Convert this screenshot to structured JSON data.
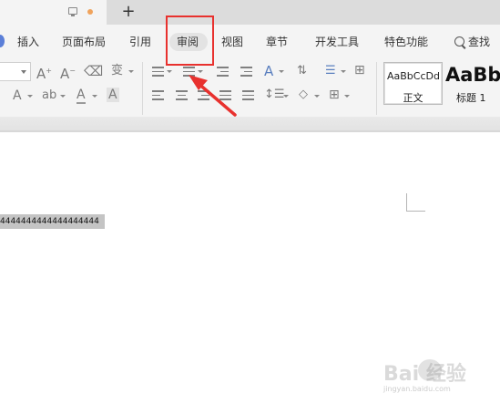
{
  "tabs": {
    "new_tab": "+"
  },
  "menu": {
    "items": [
      {
        "id": "insert",
        "label": "插入"
      },
      {
        "id": "page-layout",
        "label": "页面布局"
      },
      {
        "id": "references",
        "label": "引用"
      },
      {
        "id": "review",
        "label": "审阅",
        "active": true
      },
      {
        "id": "view",
        "label": "视图"
      },
      {
        "id": "section",
        "label": "章节"
      },
      {
        "id": "developer",
        "label": "开发工具"
      },
      {
        "id": "special",
        "label": "特色功能"
      }
    ],
    "search_label": "查找"
  },
  "ribbon": {
    "styles": [
      {
        "id": "normal",
        "sample": "AaBbCcDd",
        "name": "正文"
      },
      {
        "id": "heading1",
        "sample": "AaBb",
        "name": "标题 1"
      }
    ]
  },
  "document": {
    "selected_text": "4444444444444444444"
  },
  "annotation": {
    "color": "#e8312e"
  },
  "watermark": {
    "text": "Bai  经验",
    "url": "jingyan.baidu.com"
  }
}
